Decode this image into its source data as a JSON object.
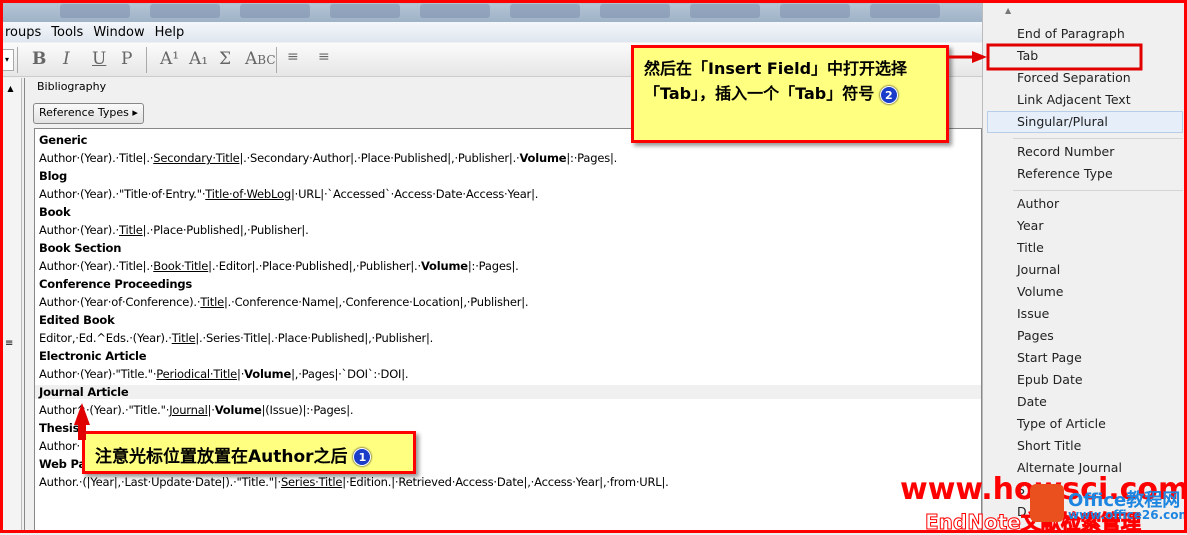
{
  "menubar": [
    "roups",
    "Tools",
    "Window",
    "Help"
  ],
  "toolbar": {
    "bold": "B",
    "italic": "I",
    "underline": "U",
    "plain": "P",
    "superscript": "A¹",
    "subscript": "A₁",
    "symbol": "Σ",
    "smallcaps": "Abc"
  },
  "group_label": "Bibliography",
  "reference_types_button": "Reference Types",
  "templates": [
    {
      "name": "Generic",
      "segments": [
        [
          "Author·(Year).·Title|.·",
          ""
        ],
        [
          "Secondary·Title",
          "u"
        ],
        [
          "|.·Secondary·Author|.·Place·Published|,·Publisher|.·",
          ""
        ],
        [
          "Volume",
          "b"
        ],
        [
          "|:·Pages|.",
          ""
        ]
      ]
    },
    {
      "name": "Blog",
      "segments": [
        [
          "Author·(Year).·\"Title·of·Entry.\"·",
          ""
        ],
        [
          "Title·of·WebLog",
          "u"
        ],
        [
          "|·URL|·`Accessed`·Access·Date·Access·Year|.",
          ""
        ]
      ]
    },
    {
      "name": "Book",
      "segments": [
        [
          "Author·(Year).·",
          ""
        ],
        [
          "Title",
          "u"
        ],
        [
          "|.·Place·Published|,·Publisher|.",
          ""
        ]
      ]
    },
    {
      "name": "Book Section",
      "segments": [
        [
          "Author·(Year).·Title|.·",
          ""
        ],
        [
          "Book·Title",
          "u"
        ],
        [
          "|.·Editor|.·Place·Published|,·Publisher|.·",
          ""
        ],
        [
          "Volume",
          "b"
        ],
        [
          "|:·Pages|.",
          ""
        ]
      ]
    },
    {
      "name": "Conference Proceedings",
      "segments": [
        [
          "Author·(Year·of·Conference).·",
          ""
        ],
        [
          "Title",
          "u"
        ],
        [
          "|.·Conference·Name|,·Conference·Location|,·Publisher|.",
          ""
        ]
      ]
    },
    {
      "name": "Edited Book",
      "segments": [
        [
          "Editor,·Ed.^Eds.·(Year).·",
          ""
        ],
        [
          "Title",
          "u"
        ],
        [
          "|.·Series·Title|.·Place·Published|,·Publisher|.",
          ""
        ]
      ]
    },
    {
      "name": "Electronic Article",
      "segments": [
        [
          "Author·(Year)·\"Title.\"·",
          ""
        ],
        [
          "Periodical·Title",
          "u"
        ],
        [
          "|·",
          ""
        ],
        [
          "Volume",
          "b"
        ],
        [
          "|,·Pages|·`DOI`:·DOI|.",
          ""
        ]
      ]
    },
    {
      "name": "Journal Article",
      "segments": [
        [
          "Author^·(Year).·\"Title.\"·",
          ""
        ],
        [
          "Journal",
          "u"
        ],
        [
          "|·",
          ""
        ],
        [
          "Volume",
          "b"
        ],
        [
          "|(Issue)|:·Pages|.",
          ""
        ]
      ]
    },
    {
      "name": "Thesis",
      "segments": [
        [
          "Author·",
          ""
        ]
      ]
    },
    {
      "name": "Web Pa",
      "segments": [
        [
          "Author.·(|Year|,·Last·Update·Date|).·\"Title.\"|·",
          ""
        ],
        [
          "Series·Title",
          "u"
        ],
        [
          "|·Edition.|·Retrieved·Access·Date|,·Access·Year|,·from·URL|.",
          ""
        ]
      ]
    }
  ],
  "insert_field_menu": {
    "group1": [
      "End of Paragraph",
      "Tab",
      "Forced Separation",
      "Link Adjacent Text",
      "Singular/Plural"
    ],
    "group2": [
      "Record Number",
      "Reference Type"
    ],
    "group3": [
      "Author",
      "Year",
      "Title",
      "Journal",
      "Volume",
      "Issue",
      "Pages",
      "Start Page",
      "Epub Date",
      "Date",
      "Type of Article",
      "Short Title",
      "Alternate Journal",
      "S",
      "D"
    ],
    "selected": "Singular/Plural"
  },
  "callout1": {
    "text": "注意光标位置放置在Author之后",
    "badge": "1"
  },
  "callout2": {
    "text": "然后在「Insert Field」中打开选择「Tab」，插入一个「Tab」符号",
    "badge": "2"
  },
  "watermark": {
    "site": "www.howsci.com",
    "sub": "EndNote文献检索管理",
    "office": "Office教程网",
    "office_url": "www.office26.com"
  },
  "colors": {
    "annotation": "#ff0000",
    "callout_bg": "#ffff80",
    "badge": "#1a3cc8"
  }
}
